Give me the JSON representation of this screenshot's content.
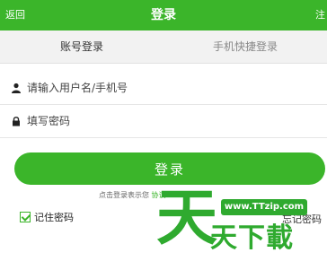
{
  "header": {
    "back_label": "返回",
    "title": "登录",
    "extra_label": "注"
  },
  "tabs": [
    {
      "label": "账号登录",
      "active": true
    },
    {
      "label": "手机快捷登录",
      "active": false
    }
  ],
  "form": {
    "username": {
      "placeholder": "请输入用户名/手机号",
      "value": "",
      "icon": "user-icon"
    },
    "password": {
      "placeholder": "填写密码",
      "value": "",
      "icon": "lock-icon"
    }
  },
  "login_button": "登录",
  "agreement": {
    "prefix": "点击登录表示您",
    "link": "协议"
  },
  "remember": {
    "label": "记住密码",
    "checked": true
  },
  "forgot_label": "忘记密码",
  "watermark": {
    "url": "www.TTzip.com",
    "big_char": "天",
    "text": "天下載"
  },
  "colors": {
    "accent": "#3bb52a",
    "tab_bg": "#f2f2f2",
    "watermark": "#2faa2f"
  }
}
